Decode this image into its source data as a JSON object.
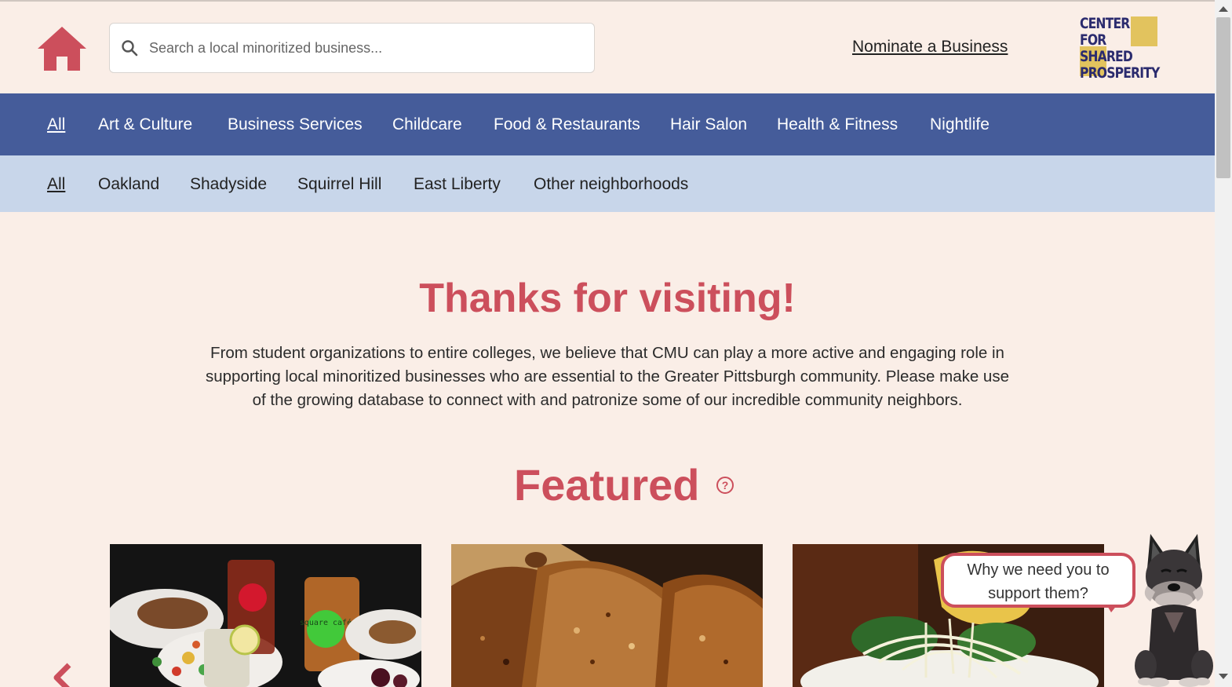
{
  "search": {
    "placeholder": "Search a local minoritized business..."
  },
  "header": {
    "nominate_label": "Nominate a Business"
  },
  "logo": {
    "lines": [
      "CENTER",
      "FOR",
      "SHARED",
      "PROSPERITY"
    ]
  },
  "categories": [
    "All",
    "Art & Culture",
    "Business Services",
    "Childcare",
    "Food & Restaurants",
    "Hair Salon",
    "Health & Fitness",
    "Nightlife"
  ],
  "neighborhoods": [
    "All",
    "Oakland",
    "Shadyside",
    "Squirrel Hill",
    "East Liberty",
    "Other neighborhoods"
  ],
  "main": {
    "heading": "Thanks for visiting!",
    "intro": "From student organizations to entire colleges, we believe that CMU can play a more active and engaging role in supporting local minoritized businesses who are essential to the Greater Pittsburgh community. Please make use of the growing database to connect with and patronize some of our incredible community neighbors.",
    "featured_title": "Featured",
    "help_symbol": "?"
  },
  "cards": [
    {
      "photo_text": "square café"
    },
    {
      "photo_text": ""
    },
    {
      "photo_text": ""
    }
  ],
  "mascot": {
    "bubble_text": "Why we need you to support them?"
  },
  "colors": {
    "accent": "#cc4f5c",
    "nav": "#455c9a",
    "subnav": "#c8d6ea",
    "background": "#faeee7",
    "logo_yellow": "#e2c35e",
    "logo_navy": "#2b2b6e"
  }
}
